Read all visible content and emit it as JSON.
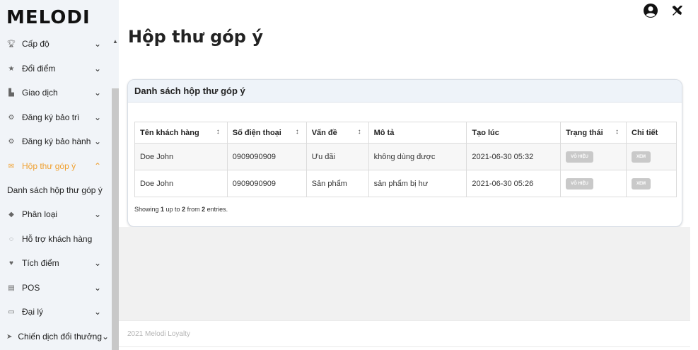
{
  "sidebar": {
    "brand": "MELODI",
    "items": [
      {
        "label": "Cấp độ",
        "icon": "trophy-icon",
        "chev": "⌄"
      },
      {
        "label": "Đổi điểm",
        "icon": "star-icon",
        "chev": "⌄"
      },
      {
        "label": "Giao dịch",
        "icon": "bag-icon",
        "chev": "⌄"
      },
      {
        "label": "Đăng ký bảo trì",
        "icon": "cogs-icon",
        "chev": "⌄"
      },
      {
        "label": "Đăng ký bảo hành",
        "icon": "cogs-icon",
        "chev": "⌄"
      },
      {
        "label": "Hộp thư góp ý",
        "icon": "envelope-icon",
        "chev": "⌃"
      },
      {
        "label": "Phân loại",
        "icon": "tags-icon",
        "chev": "⌄"
      },
      {
        "label": "Hỗ trợ khách hàng",
        "icon": "comments-icon",
        "chev": ""
      },
      {
        "label": "Tích điểm",
        "icon": "heart-icon",
        "chev": "⌄"
      },
      {
        "label": "POS",
        "icon": "receipt-icon",
        "chev": "⌄"
      },
      {
        "label": "Đại lý",
        "icon": "id-card-icon",
        "chev": "⌄"
      },
      {
        "label": "Chiến dịch đổi thưởng",
        "icon": "send-icon",
        "chev": "⌄"
      }
    ],
    "submenu_active": "Danh sách hộp thư góp ý"
  },
  "page": {
    "title": "Hộp thư góp ý"
  },
  "card": {
    "title": "Danh sách hộp thư góp ý",
    "columns": [
      "Tên khách hàng",
      "Số điện thoại",
      "Vấn đề",
      "Mô tả",
      "Tạo lúc",
      "Trạng thái",
      "Chi tiết"
    ],
    "rows": [
      {
        "name": "Doe John",
        "phone": "0909090909",
        "issue": "Ưu đãi",
        "desc": "không dùng được",
        "created": "2021-06-30 05:32",
        "status": "VÔ HIỆU",
        "detail": "XEM"
      },
      {
        "name": "Doe John",
        "phone": "0909090909",
        "issue": "Sản phẩm",
        "desc": "sản phẩm bị hư",
        "created": "2021-06-30 05:26",
        "status": "VÔ HIỆU",
        "detail": "XEM"
      }
    ],
    "showing": {
      "prefix": "Showing ",
      "from": "1",
      "mid1": " up to ",
      "to": "2",
      "mid2": " from ",
      "total": "2",
      "suffix": " entries."
    }
  },
  "footer": {
    "text": "2021 Melodi Loyalty"
  },
  "colors": {
    "accent": "#f0a030",
    "badge": "#c9c9c9"
  }
}
